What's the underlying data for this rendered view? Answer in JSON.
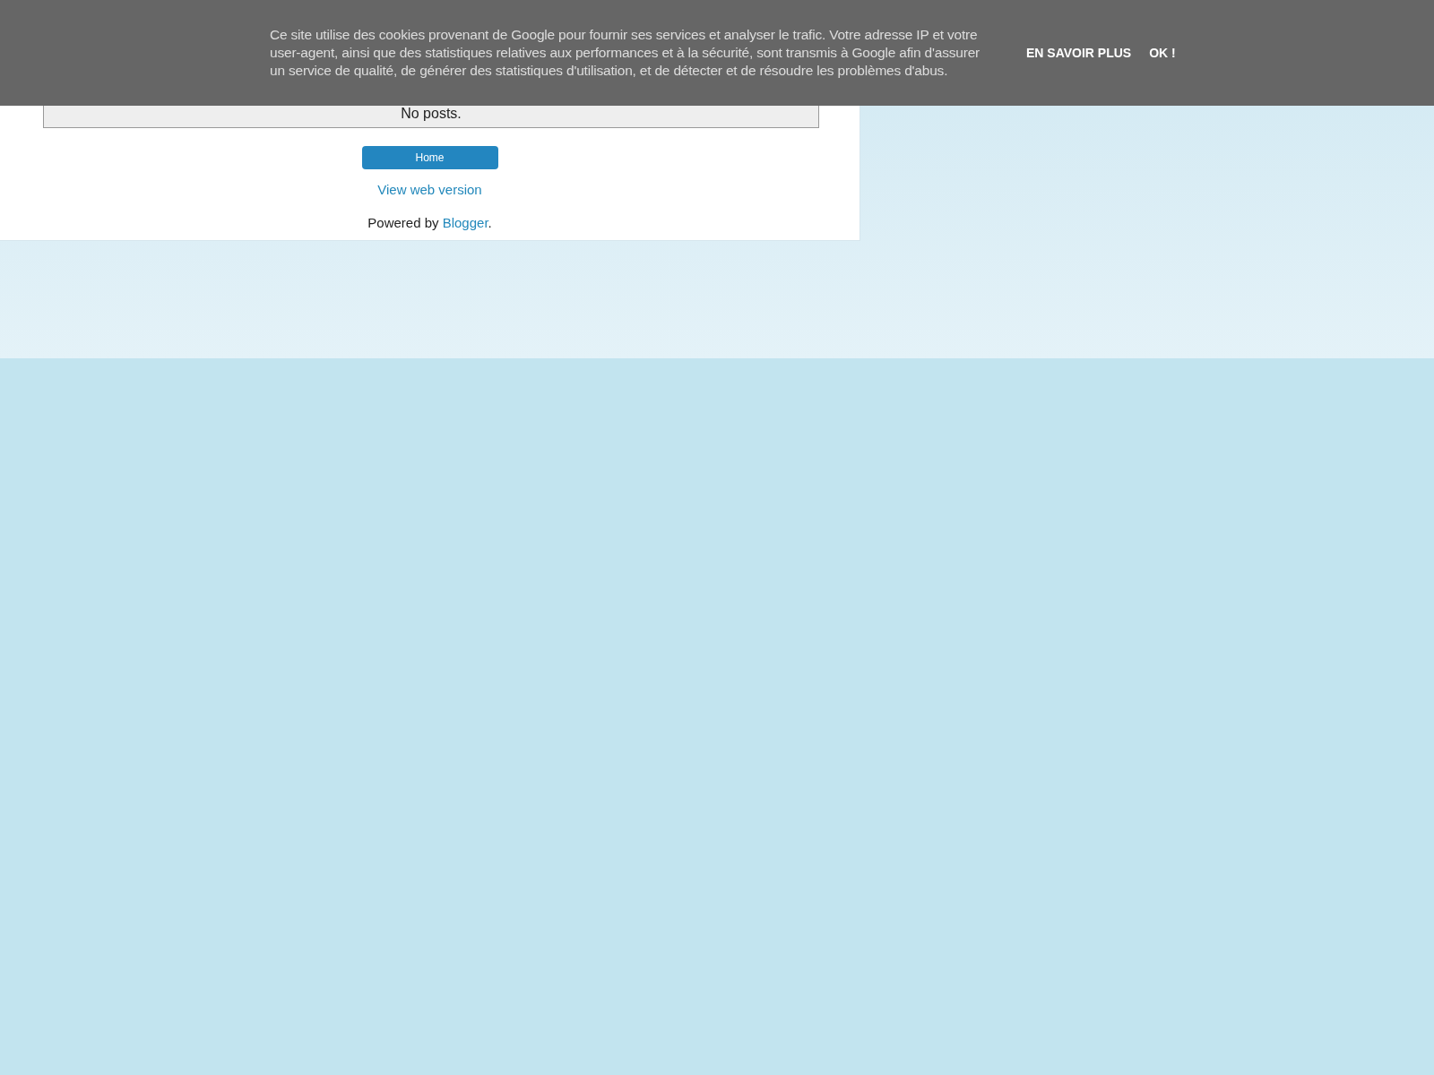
{
  "cookie_notice": {
    "message": "Ce site utilise des cookies provenant de Google pour fournir ses services et analyser le trafic. Votre adresse IP et votre user-agent, ainsi que des statistiques relatives aux performances et à la sécurité, sont transmis à Google afin d'assurer un service de qualité, de générer des statistiques d'utilisation, et de détecter et de résoudre les problèmes d'abus.",
    "buttons": [
      "EN SAVOIR PLUS",
      "OK !"
    ]
  },
  "posts": {
    "empty_message": "No posts."
  },
  "footer": {
    "home_button": "Home",
    "web_version_link": "View web version",
    "powered_by": "Powered by ",
    "powered_by_link": "Blogger",
    "powered_by_end": "."
  }
}
